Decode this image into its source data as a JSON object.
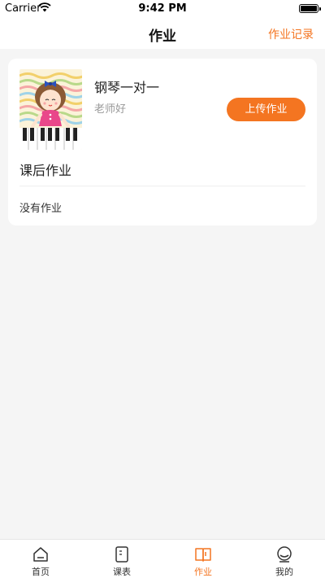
{
  "status_bar": {
    "carrier": "Carrier",
    "time": "9:42 PM"
  },
  "header": {
    "title": "作业",
    "action": "作业记录"
  },
  "course": {
    "name": "钢琴一对一",
    "teacher": "老师好",
    "upload_label": "上传作业",
    "homework_title": "课后作业",
    "empty_text": "没有作业"
  },
  "tabs": [
    {
      "label": "首页",
      "icon": "home-icon",
      "active": false
    },
    {
      "label": "课表",
      "icon": "schedule-icon",
      "active": false
    },
    {
      "label": "作业",
      "icon": "homework-book-icon",
      "active": true
    },
    {
      "label": "我的",
      "icon": "profile-icon",
      "active": false
    }
  ],
  "colors": {
    "accent": "#f47521",
    "background": "#f5f5f5",
    "card": "#ffffff"
  }
}
